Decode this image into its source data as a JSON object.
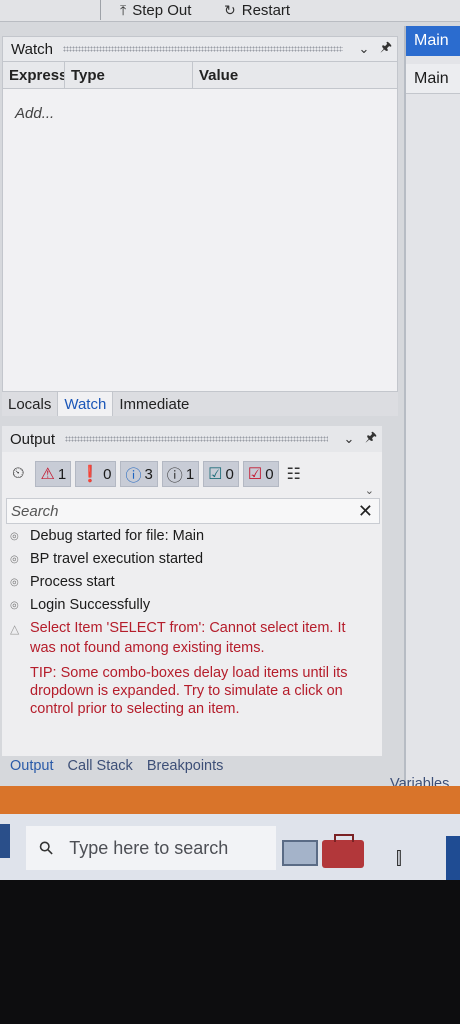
{
  "toolbar": {
    "step_out": "Step Out",
    "restart": "Restart"
  },
  "watch": {
    "title": "Watch",
    "columns": [
      "Express",
      "Type",
      "Value"
    ],
    "add_placeholder": "Add..."
  },
  "mid_tabs": [
    "Locals",
    "Watch",
    "Immediate"
  ],
  "output": {
    "title": "Output",
    "filters": {
      "warnings": "1",
      "errors": "0",
      "info": "3",
      "trace": "1",
      "success": "0",
      "failed": "0"
    },
    "search_placeholder": "Search",
    "log": [
      "Debug started for file: Main",
      "BP travel execution started",
      "Process start",
      "Login Successfully"
    ],
    "warning": "Select Item 'SELECT from': Cannot select item. It was not found among existing items.",
    "tip": "TIP: Some combo-boxes delay load items until its dropdown is expanded. Try to simulate a click on control prior to selecting an item."
  },
  "bottom_tabs": [
    "Output",
    "Call Stack",
    "Breakpoints"
  ],
  "right_panel": {
    "header": "Main",
    "sub": "Main",
    "variables": "Variables"
  },
  "taskbar": {
    "search_placeholder": "Type here to search"
  },
  "colors": {
    "accent": "#2b6ccf",
    "status_bar": "#d9742a",
    "error_text": "#b51d2b"
  }
}
